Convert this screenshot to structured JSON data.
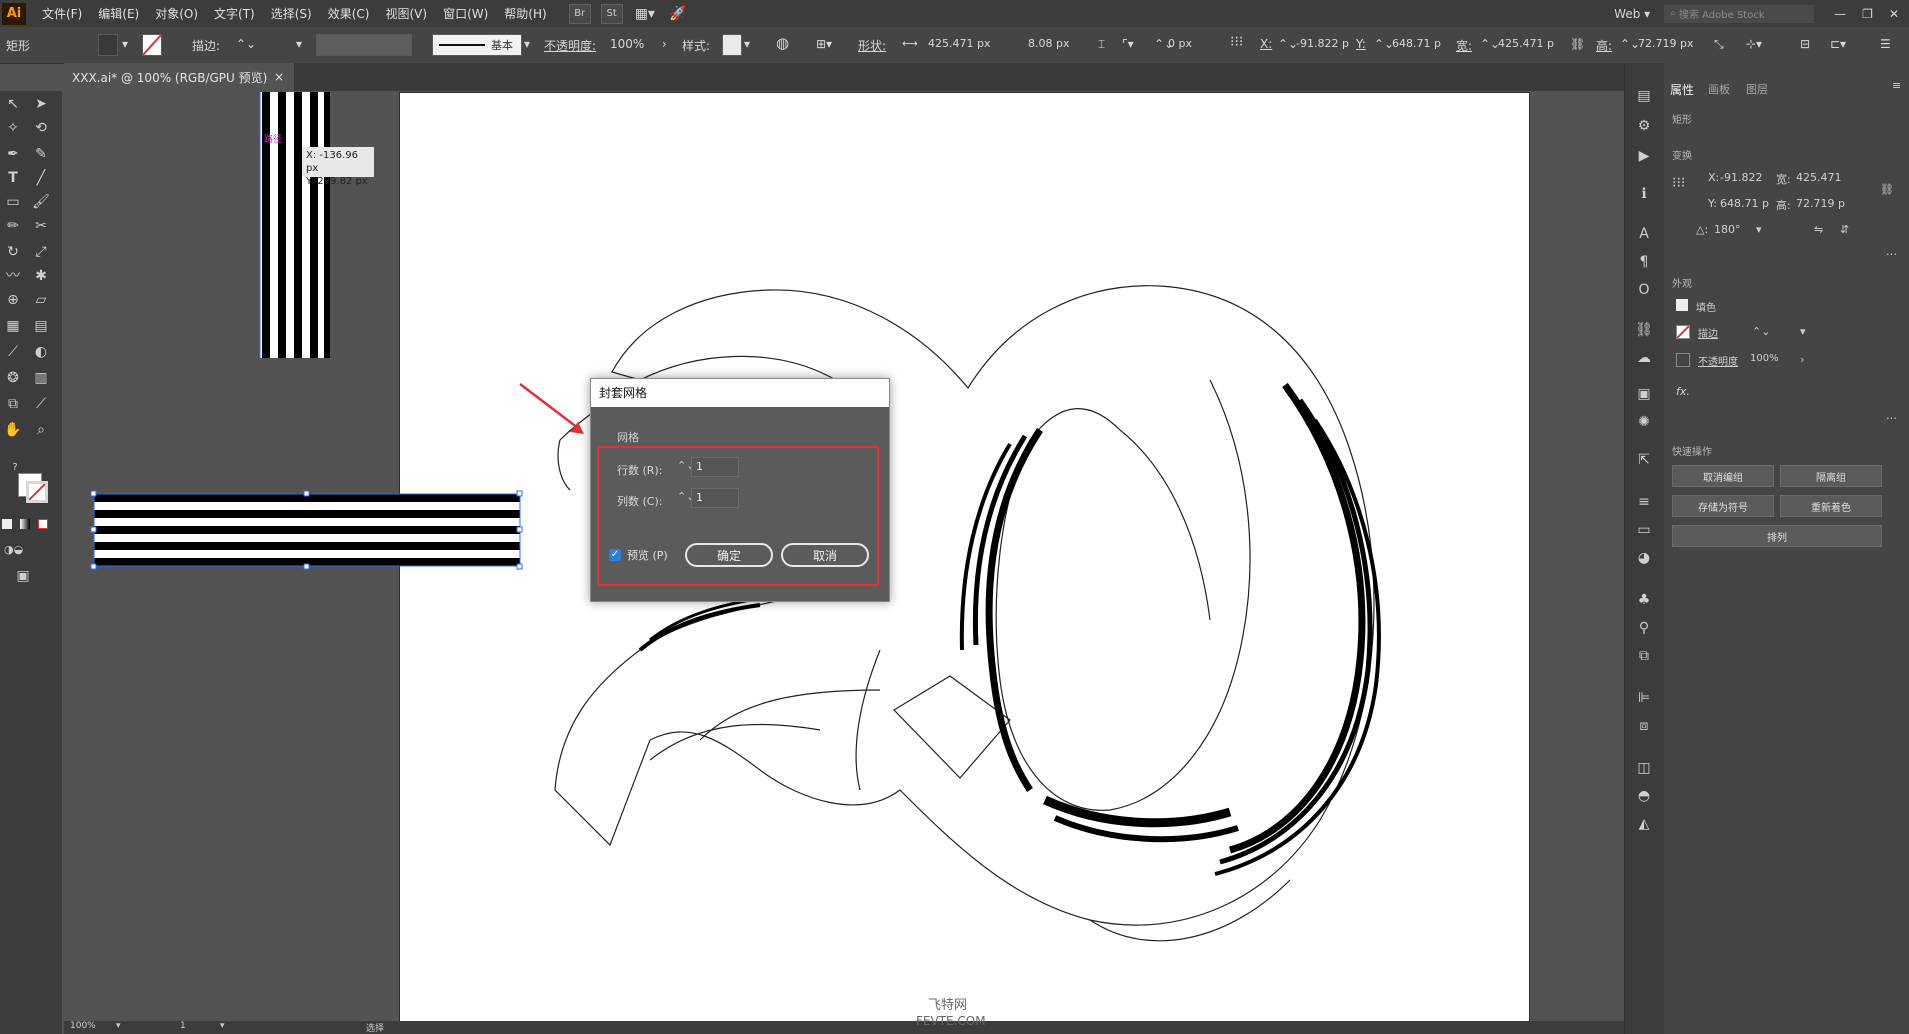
{
  "menu": {
    "logo": "Ai",
    "items": [
      "文件(F)",
      "编辑(E)",
      "对象(O)",
      "文字(T)",
      "选择(S)",
      "效果(C)",
      "视图(V)",
      "窗口(W)",
      "帮助(H)"
    ],
    "bridge": "Br",
    "stock": "St",
    "workspace": "Web",
    "search_placeholder": "搜索 Adobe Stock"
  },
  "control": {
    "object_type": "矩形",
    "stroke_label": "描边:",
    "stroke_profile": "基本",
    "opacity_label": "不透明度:",
    "opacity_value": "100%",
    "style_label": "样式:",
    "shape_label": "形状:",
    "width_field": "425.471 px",
    "height_field": "8.08 px",
    "corner": "0 px",
    "x_label": "X:",
    "x_value": "-91.822 p",
    "y_label": "Y:",
    "y_value": "648.71 p",
    "w_label": "宽:",
    "w_value": "425.471 p",
    "h_label": "高:",
    "h_value": "72.719 px"
  },
  "tab": {
    "title": "XXX.ai* @ 100% (RGB/GPU 预览)",
    "close": "×"
  },
  "tooltip": {
    "line1": "X: -136.96 px",
    "line2": "Y: 299.82 px",
    "anchor_hint": "路径"
  },
  "dialog": {
    "title": "封套网格",
    "group_label": "网格",
    "rows_label": "行数 (R):",
    "rows_value": "1",
    "cols_label": "列数 (C):",
    "cols_value": "1",
    "preview_label": "预览 (P)",
    "preview_checked": true,
    "ok_label": "确定",
    "cancel_label": "取消"
  },
  "panel": {
    "tabs": [
      "属性",
      "画板",
      "图层"
    ],
    "section_shape": "矩形",
    "section_transform": "变换",
    "x_label": "X:",
    "x_value": "-91.822",
    "w_label": "宽:",
    "w_value": "425.471",
    "y_label": "Y:",
    "y_value": "648.71 p",
    "h_label": "高:",
    "h_value": "72.719 p",
    "angle_label": "△:",
    "angle_value": "180°",
    "section_appearance": "外观",
    "fill_label": "填色",
    "stroke_label": "描边",
    "opacity_label": "不透明度",
    "opacity_value": "100%",
    "fx": "fx.",
    "section_quick": "快速操作",
    "btn_ungroup": "取消编组",
    "btn_isolate": "隔离组",
    "btn_symbol": "存储为符号",
    "btn_recolor": "重新着色",
    "btn_arrange": "排列"
  },
  "status": {
    "zoom": "100%",
    "artboard": "1",
    "mode": "选择"
  },
  "watermark": {
    "line1": "飞特网",
    "line2": "FEVTE.COM"
  },
  "colors": {
    "dialog_highlight": "#e0303a",
    "arrow": "#e0303a",
    "selection": "#2a6cff",
    "app_bg": "#535353"
  }
}
